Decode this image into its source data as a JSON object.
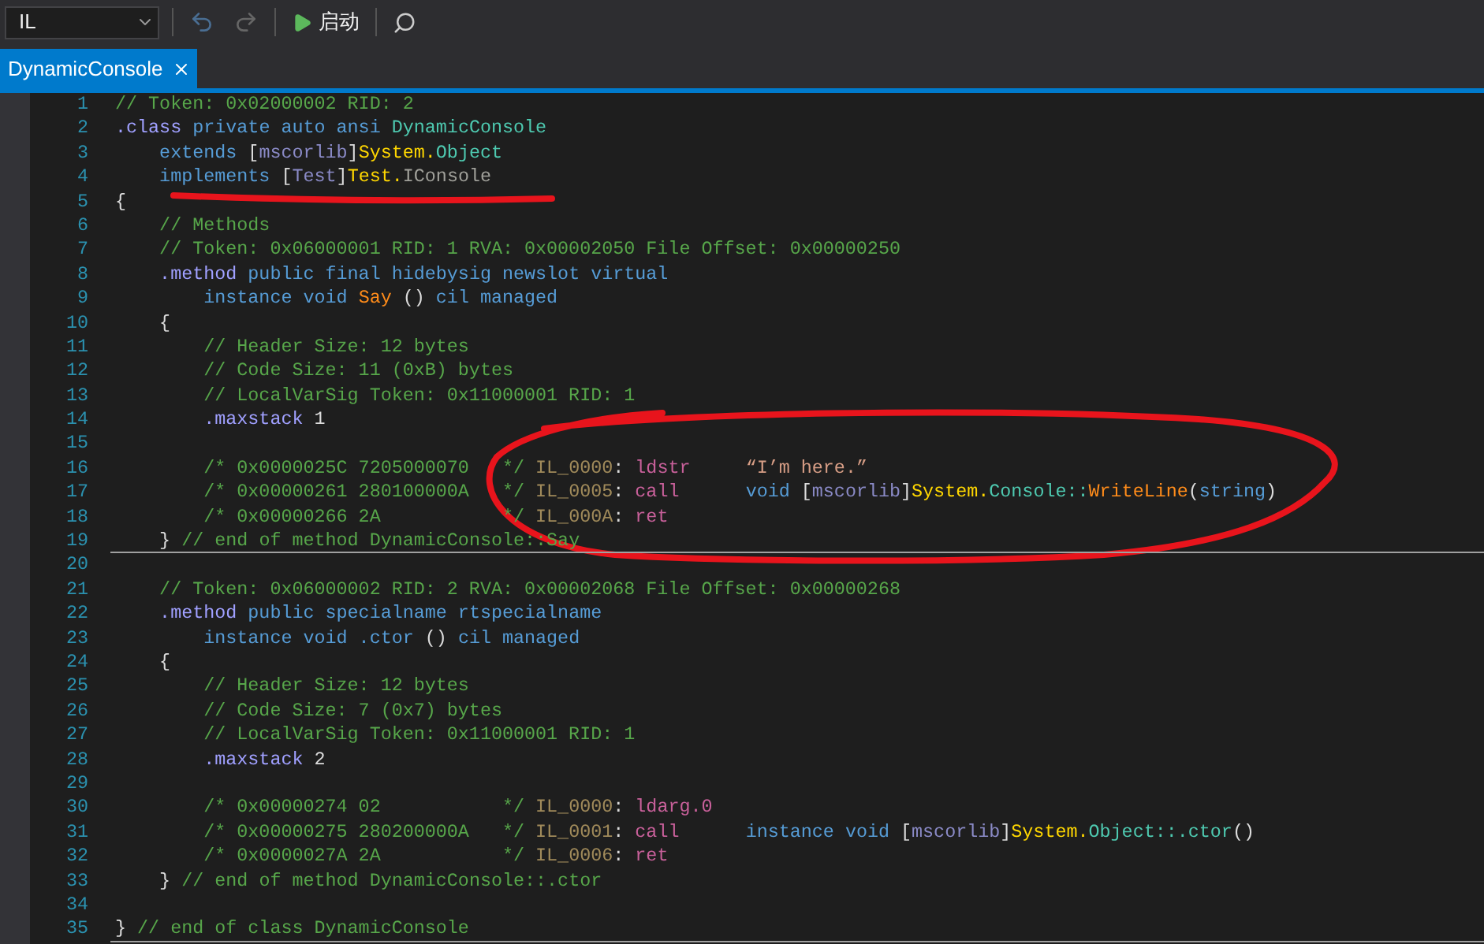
{
  "toolbar": {
    "combo": {
      "value": "IL"
    },
    "undo": {
      "disabled": false
    },
    "redo": {
      "disabled": true
    },
    "start_button": {
      "label": "启动"
    }
  },
  "tabs": [
    {
      "label": "DynamicConsole",
      "selected": true
    }
  ],
  "editor": {
    "lines": [
      {
        "number": "1",
        "separator": false,
        "tokens": [
          {
            "text": "// Token: 0x02000002 RID: 2",
            "kind": "comment"
          }
        ]
      },
      {
        "number": "2",
        "separator": false,
        "tokens": [
          {
            "text": ".class",
            "kind": "directive"
          },
          {
            "text": " private auto ansi ",
            "kind": "keyword"
          },
          {
            "text": "DynamicConsole",
            "kind": "class"
          }
        ]
      },
      {
        "number": "3",
        "separator": false,
        "tokens": [
          {
            "text": "    extends",
            "kind": "keyword"
          },
          {
            "text": " [",
            "kind": "plain"
          },
          {
            "text": "mscorlib",
            "kind": "assembly"
          },
          {
            "text": "]",
            "kind": "plain"
          },
          {
            "text": "System.",
            "kind": "namespace"
          },
          {
            "text": "Object",
            "kind": "class"
          }
        ]
      },
      {
        "number": "4",
        "separator": false,
        "tokens": [
          {
            "text": "    implements",
            "kind": "keyword"
          },
          {
            "text": " [",
            "kind": "plain"
          },
          {
            "text": "Test",
            "kind": "assembly"
          },
          {
            "text": "]",
            "kind": "plain"
          },
          {
            "text": "Test.",
            "kind": "namespace"
          },
          {
            "text": "IConsole",
            "kind": "type"
          }
        ]
      },
      {
        "number": "5",
        "separator": false,
        "tokens": [
          {
            "text": "{",
            "kind": "plain"
          }
        ]
      },
      {
        "number": "6",
        "separator": false,
        "tokens": [
          {
            "text": "    // Methods",
            "kind": "comment"
          }
        ]
      },
      {
        "number": "7",
        "separator": false,
        "tokens": [
          {
            "text": "    // Token: 0x06000001 RID: 1 RVA: 0x00002050 File Offset: 0x00000250",
            "kind": "comment"
          }
        ]
      },
      {
        "number": "8",
        "separator": false,
        "tokens": [
          {
            "text": "    .method",
            "kind": "directive"
          },
          {
            "text": " public final hidebysig newslot virtual",
            "kind": "keyword"
          }
        ]
      },
      {
        "number": "9",
        "separator": false,
        "tokens": [
          {
            "text": "        instance void ",
            "kind": "keyword"
          },
          {
            "text": "Say",
            "kind": "method"
          },
          {
            "text": " () ",
            "kind": "plain"
          },
          {
            "text": "cil managed",
            "kind": "keyword"
          }
        ]
      },
      {
        "number": "10",
        "separator": false,
        "tokens": [
          {
            "text": "    {",
            "kind": "plain"
          }
        ]
      },
      {
        "number": "11",
        "separator": false,
        "tokens": [
          {
            "text": "        // Header Size: 12 bytes",
            "kind": "comment"
          }
        ]
      },
      {
        "number": "12",
        "separator": false,
        "tokens": [
          {
            "text": "        // Code Size: 11 (0xB) bytes",
            "kind": "comment"
          }
        ]
      },
      {
        "number": "13",
        "separator": false,
        "tokens": [
          {
            "text": "        // LocalVarSig Token: 0x11000001 RID: 1",
            "kind": "comment"
          }
        ]
      },
      {
        "number": "14",
        "separator": false,
        "tokens": [
          {
            "text": "        .maxstack",
            "kind": "directive"
          },
          {
            "text": " 1",
            "kind": "plain"
          }
        ]
      },
      {
        "number": "15",
        "separator": false
      },
      {
        "number": "16",
        "separator": false,
        "tokens": [
          {
            "text": "        /* 0x0000025C 7205000070   */ ",
            "kind": "comment"
          },
          {
            "text": "IL_0000",
            "kind": "label"
          },
          {
            "text": ": ",
            "kind": "plain"
          },
          {
            "text": "ldstr",
            "kind": "opcode"
          },
          {
            "text": "     “I’m here.”",
            "kind": "string"
          }
        ]
      },
      {
        "number": "17",
        "separator": false,
        "tokens": [
          {
            "text": "        /* 0x00000261 280100000A   */ ",
            "kind": "comment"
          },
          {
            "text": "IL_0005",
            "kind": "label"
          },
          {
            "text": ": ",
            "kind": "plain"
          },
          {
            "text": "call",
            "kind": "opcode"
          },
          {
            "text": "      void",
            "kind": "keyword"
          },
          {
            "text": " [",
            "kind": "plain"
          },
          {
            "text": "mscorlib",
            "kind": "assembly"
          },
          {
            "text": "]",
            "kind": "plain"
          },
          {
            "text": "System.",
            "kind": "namespace"
          },
          {
            "text": "Console::",
            "kind": "class"
          },
          {
            "text": "WriteLine",
            "kind": "method"
          },
          {
            "text": "(",
            "kind": "plain"
          },
          {
            "text": "string",
            "kind": "keyword"
          },
          {
            "text": ")",
            "kind": "plain"
          }
        ]
      },
      {
        "number": "18",
        "separator": false,
        "tokens": [
          {
            "text": "        /* 0x00000266 2A           */ ",
            "kind": "comment"
          },
          {
            "text": "IL_000A",
            "kind": "label"
          },
          {
            "text": ": ",
            "kind": "plain"
          },
          {
            "text": "ret",
            "kind": "opcode"
          }
        ]
      },
      {
        "number": "19",
        "separator": true,
        "tokens": [
          {
            "text": "    } ",
            "kind": "plain"
          },
          {
            "text": "// end of method DynamicConsole::Say",
            "kind": "comment"
          }
        ]
      },
      {
        "number": "20",
        "separator": false
      },
      {
        "number": "21",
        "separator": false,
        "tokens": [
          {
            "text": "    // Token: 0x06000002 RID: 2 RVA: 0x00002068 File Offset: 0x00000268",
            "kind": "comment"
          }
        ]
      },
      {
        "number": "22",
        "separator": false,
        "tokens": [
          {
            "text": "    .method",
            "kind": "directive"
          },
          {
            "text": " public specialname rtspecialname",
            "kind": "keyword"
          }
        ]
      },
      {
        "number": "23",
        "separator": false,
        "tokens": [
          {
            "text": "        instance void .ctor",
            "kind": "keyword"
          },
          {
            "text": " () ",
            "kind": "plain"
          },
          {
            "text": "cil managed",
            "kind": "keyword"
          }
        ]
      },
      {
        "number": "24",
        "separator": false,
        "tokens": [
          {
            "text": "    {",
            "kind": "plain"
          }
        ]
      },
      {
        "number": "25",
        "separator": false,
        "tokens": [
          {
            "text": "        // Header Size: 12 bytes",
            "kind": "comment"
          }
        ]
      },
      {
        "number": "26",
        "separator": false,
        "tokens": [
          {
            "text": "        // Code Size: 7 (0x7) bytes",
            "kind": "comment"
          }
        ]
      },
      {
        "number": "27",
        "separator": false,
        "tokens": [
          {
            "text": "        // LocalVarSig Token: 0x11000001 RID: 1",
            "kind": "comment"
          }
        ]
      },
      {
        "number": "28",
        "separator": false,
        "tokens": [
          {
            "text": "        .maxstack",
            "kind": "directive"
          },
          {
            "text": " 2",
            "kind": "plain"
          }
        ]
      },
      {
        "number": "29",
        "separator": false
      },
      {
        "number": "30",
        "separator": false,
        "tokens": [
          {
            "text": "        /* 0x00000274 02           */ ",
            "kind": "comment"
          },
          {
            "text": "IL_0000",
            "kind": "label"
          },
          {
            "text": ": ",
            "kind": "plain"
          },
          {
            "text": "ldarg.0",
            "kind": "opcode"
          }
        ]
      },
      {
        "number": "31",
        "separator": false,
        "tokens": [
          {
            "text": "        /* 0x00000275 280200000A   */ ",
            "kind": "comment"
          },
          {
            "text": "IL_0001",
            "kind": "label"
          },
          {
            "text": ": ",
            "kind": "plain"
          },
          {
            "text": "call",
            "kind": "opcode"
          },
          {
            "text": "      instance void",
            "kind": "keyword"
          },
          {
            "text": " [",
            "kind": "plain"
          },
          {
            "text": "mscorlib",
            "kind": "assembly"
          },
          {
            "text": "]",
            "kind": "plain"
          },
          {
            "text": "System.",
            "kind": "namespace"
          },
          {
            "text": "Object::.ctor",
            "kind": "class"
          },
          {
            "text": "()",
            "kind": "plain"
          }
        ]
      },
      {
        "number": "32",
        "separator": false,
        "tokens": [
          {
            "text": "        /* 0x0000027A 2A           */ ",
            "kind": "comment"
          },
          {
            "text": "IL_0006",
            "kind": "label"
          },
          {
            "text": ": ",
            "kind": "plain"
          },
          {
            "text": "ret",
            "kind": "opcode"
          }
        ]
      },
      {
        "number": "33",
        "separator": false,
        "tokens": [
          {
            "text": "    } ",
            "kind": "plain"
          },
          {
            "text": "// end of method DynamicConsole::.ctor",
            "kind": "comment"
          }
        ]
      },
      {
        "number": "34",
        "separator": false
      },
      {
        "number": "35",
        "separator": true,
        "tokens": [
          {
            "text": "} ",
            "kind": "plain"
          },
          {
            "text": "// end of class DynamicConsole",
            "kind": "comment"
          }
        ]
      }
    ]
  }
}
